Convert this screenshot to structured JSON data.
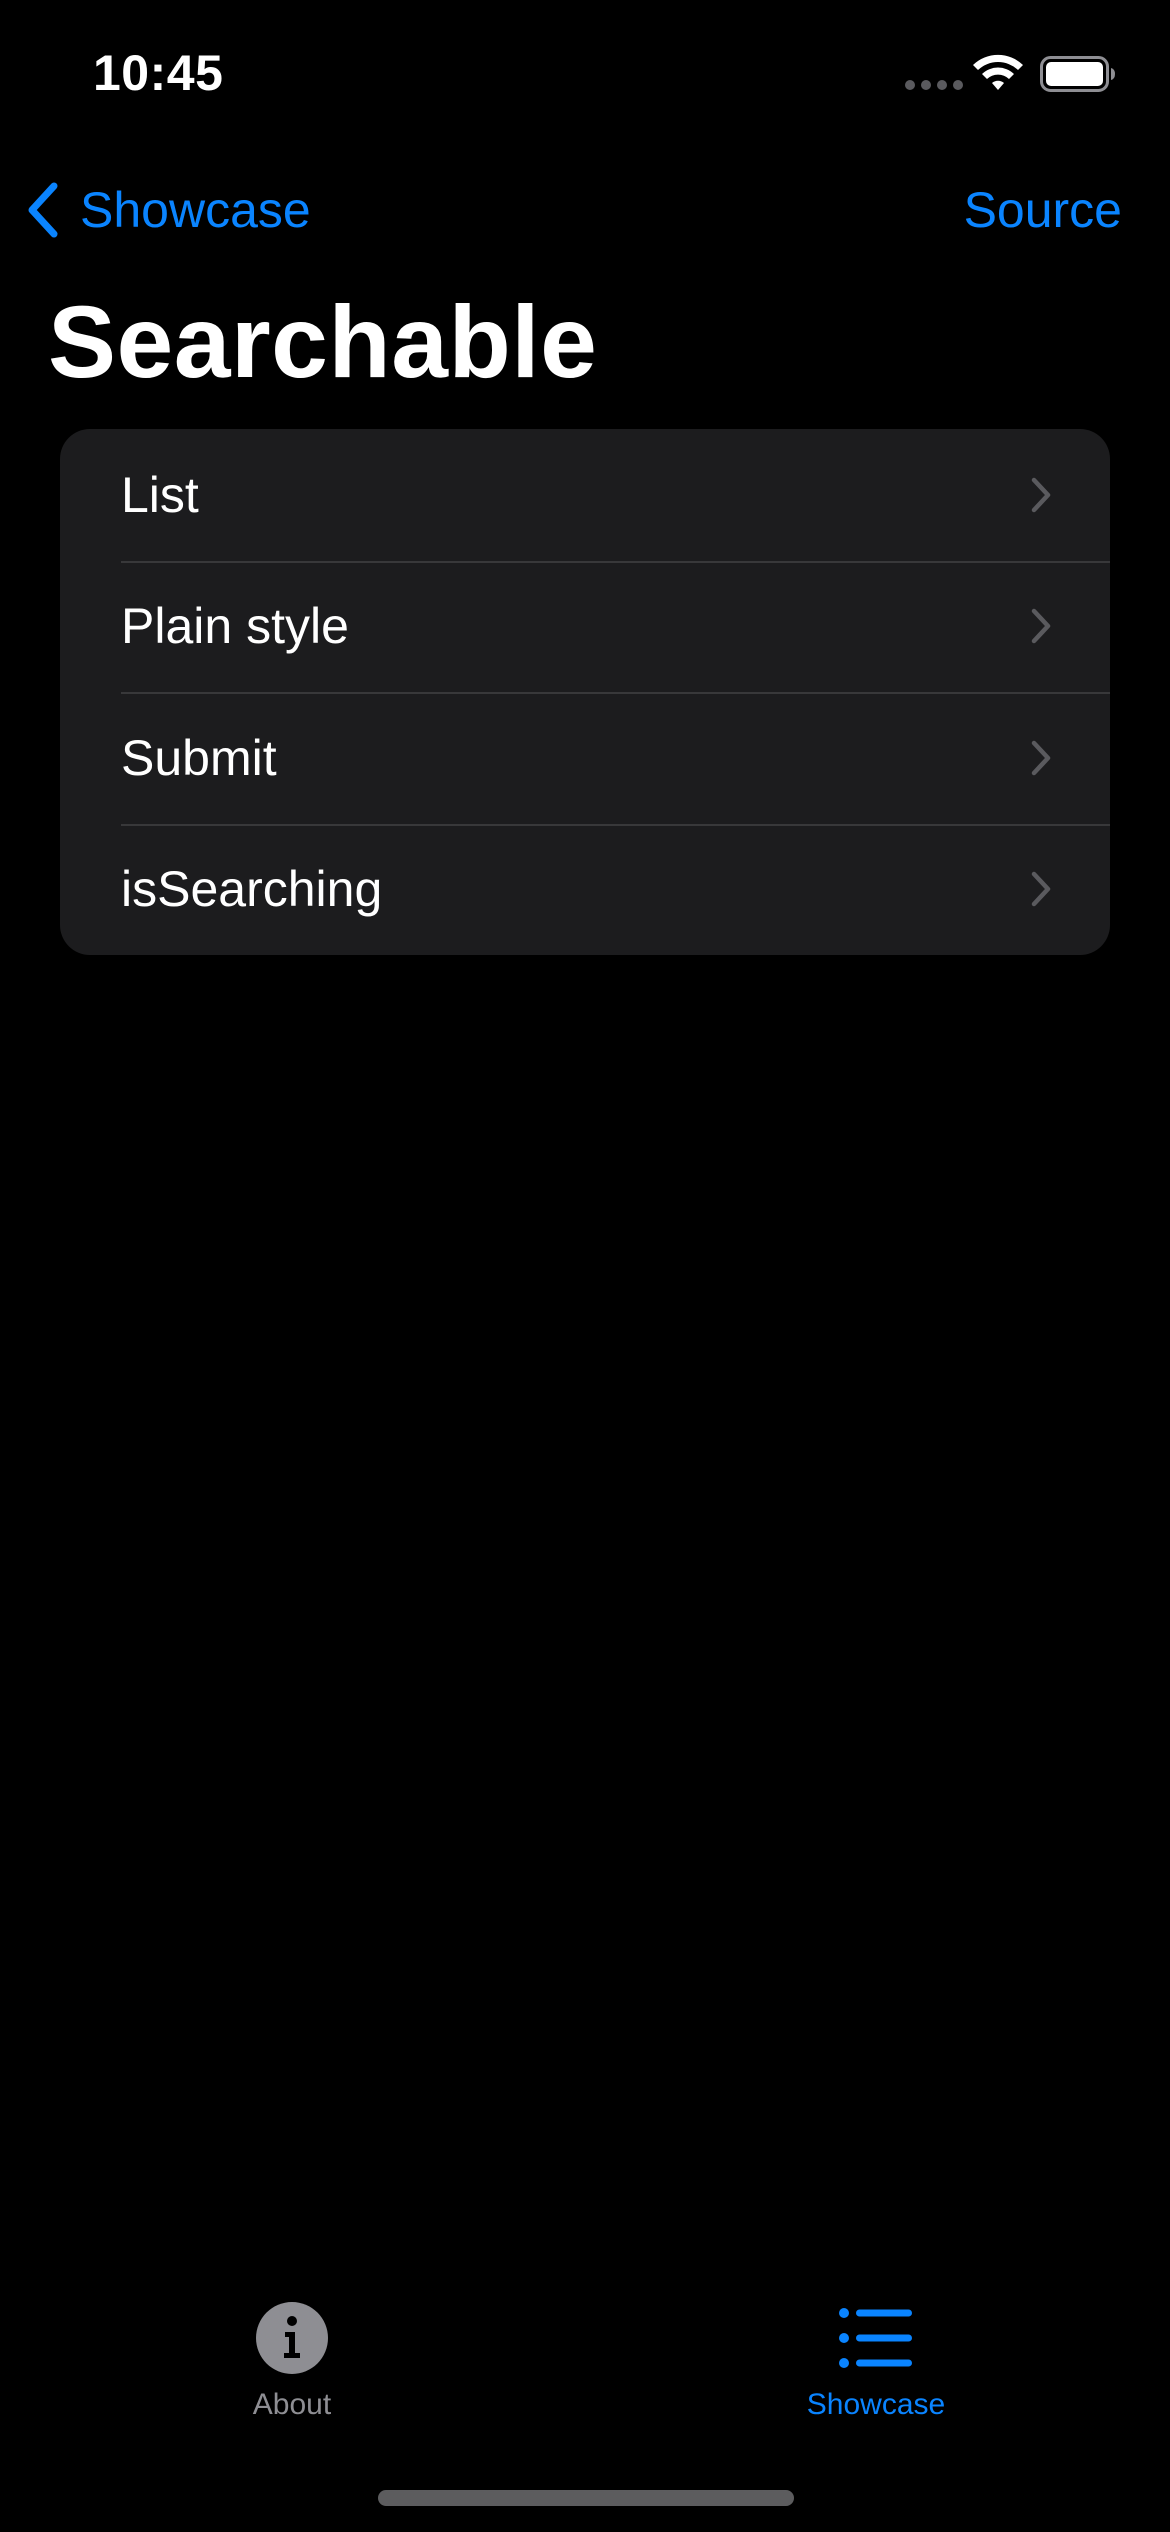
{
  "status_bar": {
    "time": "10:45"
  },
  "nav_bar": {
    "back_label": "Showcase",
    "action_label": "Source"
  },
  "page": {
    "title": "Searchable"
  },
  "list": {
    "items": [
      {
        "label": "List"
      },
      {
        "label": "Plain style"
      },
      {
        "label": "Submit"
      },
      {
        "label": "isSearching"
      }
    ]
  },
  "tab_bar": {
    "tabs": [
      {
        "label": "About",
        "icon": "info-circle-icon",
        "selected": false
      },
      {
        "label": "Showcase",
        "icon": "list-bullet-icon",
        "selected": true
      }
    ]
  },
  "colors": {
    "accent": "#0a84ff",
    "background": "#000000",
    "cell_background": "#1c1c1e",
    "separator": "#38383a",
    "inactive_tab": "#8e8e93"
  }
}
